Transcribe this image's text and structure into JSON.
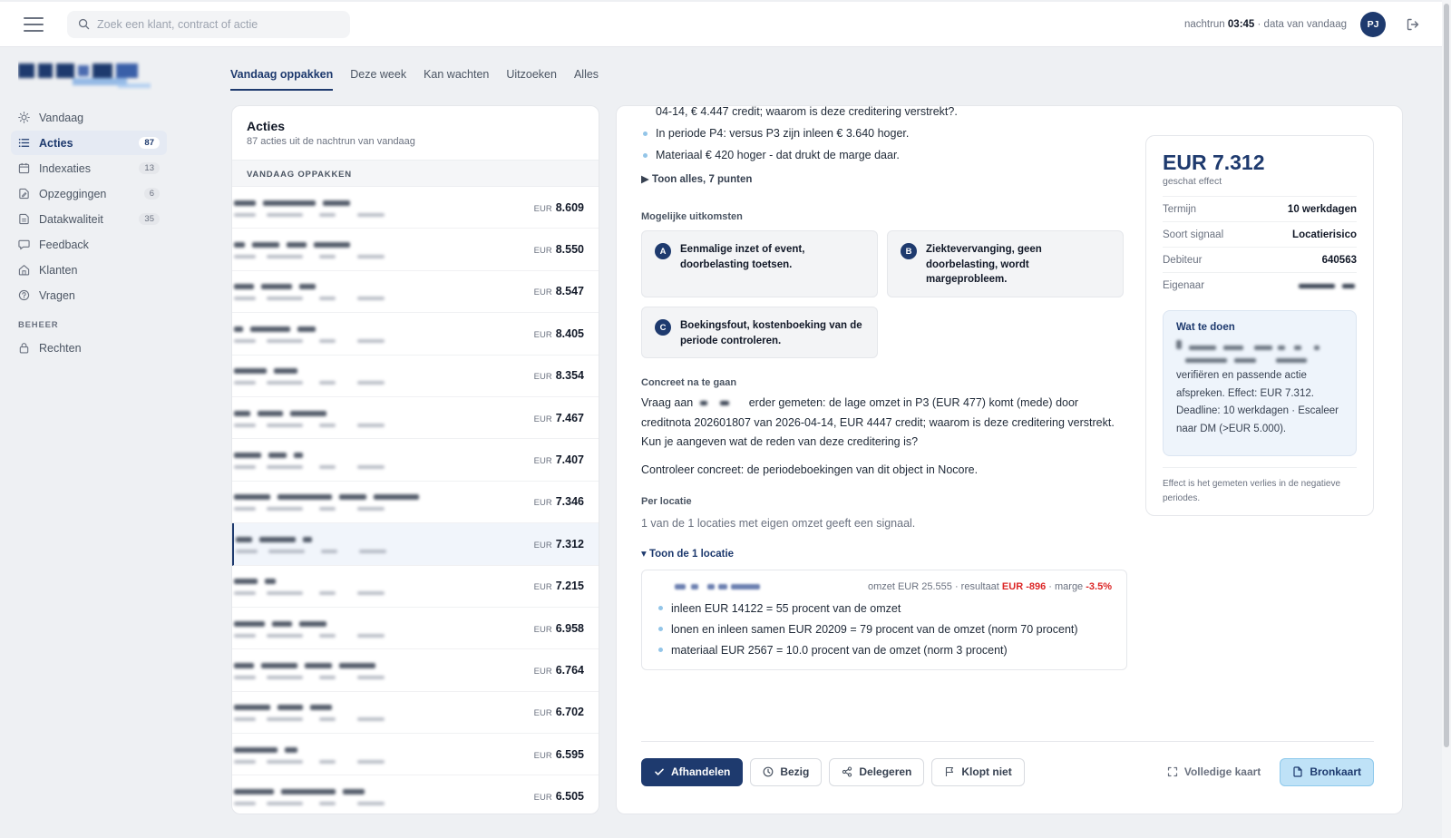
{
  "search": {
    "placeholder": "Zoek een klant, contract of actie"
  },
  "topbar": {
    "nightrun_prefix": "nachtrun",
    "nightrun_time": "03:45",
    "nightrun_suffix": "· data van vandaag",
    "avatar_initials": "PJ"
  },
  "sidebar": {
    "items": [
      {
        "label": "Vandaag",
        "icon": "sun-icon",
        "badge": ""
      },
      {
        "label": "Acties",
        "icon": "list-icon",
        "badge": "87",
        "active": true
      },
      {
        "label": "Indexaties",
        "icon": "calendar-icon",
        "badge": "13"
      },
      {
        "label": "Opzeggingen",
        "icon": "document-edit-icon",
        "badge": "6"
      },
      {
        "label": "Datakwaliteit",
        "icon": "database-icon",
        "badge": "35"
      },
      {
        "label": "Feedback",
        "icon": "chat-icon",
        "badge": ""
      },
      {
        "label": "Klanten",
        "icon": "home-icon",
        "badge": ""
      },
      {
        "label": "Vragen",
        "icon": "help-chat-icon",
        "badge": ""
      }
    ],
    "section_label": "BEHEER",
    "admin_items": [
      {
        "label": "Rechten",
        "icon": "lock-icon"
      }
    ]
  },
  "tabs": [
    "Vandaag oppakken",
    "Deze week",
    "Kan wachten",
    "Uitzoeken",
    "Alles"
  ],
  "list": {
    "title": "Acties",
    "subtitle": "87 acties uit de nachtrun van vandaag",
    "section": "VANDAAG OPPAKKEN",
    "currency": "EUR",
    "amounts": [
      "8.609",
      "8.550",
      "8.547",
      "8.405",
      "8.354",
      "7.467",
      "7.407",
      "7.346",
      "7.312",
      "7.215",
      "6.958",
      "6.764",
      "6.702",
      "6.595",
      "6.505"
    ],
    "selected_index": 8
  },
  "detail": {
    "top_line": "04-14, € 4.447 credit; waarom is deze creditering verstrekt?.",
    "bullets": [
      "In periode P4: versus P3 zijn inleen € 3.640 hoger.",
      "Materiaal € 420 hoger - dat drukt de marge daar."
    ],
    "show_all": "▶ Toon alles, 7 punten",
    "outcomes_title": "Mogelijke uitkomsten",
    "outcomes": [
      {
        "letter": "A",
        "text": "Eenmalige inzet of event, doorbelasting toetsen."
      },
      {
        "letter": "B",
        "text": "Ziektevervanging, geen doorbelasting, wordt margeprobleem."
      },
      {
        "letter": "C",
        "text": "Boekingsfout, kostenboeking van de periode controleren."
      }
    ],
    "concrete_title": "Concreet na te gaan",
    "concrete_p1_start": "Vraag aan",
    "concrete_p1_rest": "erder gemeten: de lage omzet in P3 (EUR 477) komt (mede) door creditnota 202601807 van 2026-04-14, EUR 4447 credit; waarom is deze creditering verstrekt. Kun je aangeven wat de reden van deze creditering is?",
    "concrete_p2": "Controleer concreet: de periodeboekingen van dit object in Nocore.",
    "per_location_title": "Per locatie",
    "per_location_text": "1 van de 1 locaties met eigen omzet geeft een signaal.",
    "show_locations": "Toon de 1 locatie",
    "location": {
      "summary_prefix": "omzet EUR 25.555 · resultaat",
      "result": "EUR -896",
      "margin_prefix": "· marge",
      "margin": "-3.5%",
      "lines": [
        "inleen EUR 14122 = 55 procent van de omzet",
        "lonen en inleen samen EUR 20209 = 79 procent van de omzet (norm 70 procent)",
        "materiaal EUR 2567 = 10.0 procent van de omzet (norm 3 procent)"
      ]
    }
  },
  "effect": {
    "amount": "EUR 7.312",
    "subtitle": "geschat effect",
    "rows": [
      {
        "key": "Termijn",
        "value": "10 werkdagen"
      },
      {
        "key": "Soort signaal",
        "value": "Locatierisico"
      },
      {
        "key": "Debiteur",
        "value": "640563"
      },
      {
        "key": "Eigenaar",
        "value": ""
      }
    ],
    "todo_title": "Wat te doen",
    "todo_text": "verifiëren en passende actie afspreken. Effect: EUR 7.312. Deadline: 10 werkdagen · Escaleer naar DM (>EUR 5.000).",
    "footnote": "Effect is het gemeten verlies in de negatieve periodes."
  },
  "actions": {
    "handle": "Afhandelen",
    "busy": "Bezig",
    "delegate": "Delegeren",
    "wrong": "Klopt niet",
    "full_card": "Volledige kaart",
    "source_card": "Bronkaart"
  },
  "colors": {
    "brand": "#1e3a6e",
    "negative": "#dc2626",
    "accent_light": "#bfe2f7"
  }
}
